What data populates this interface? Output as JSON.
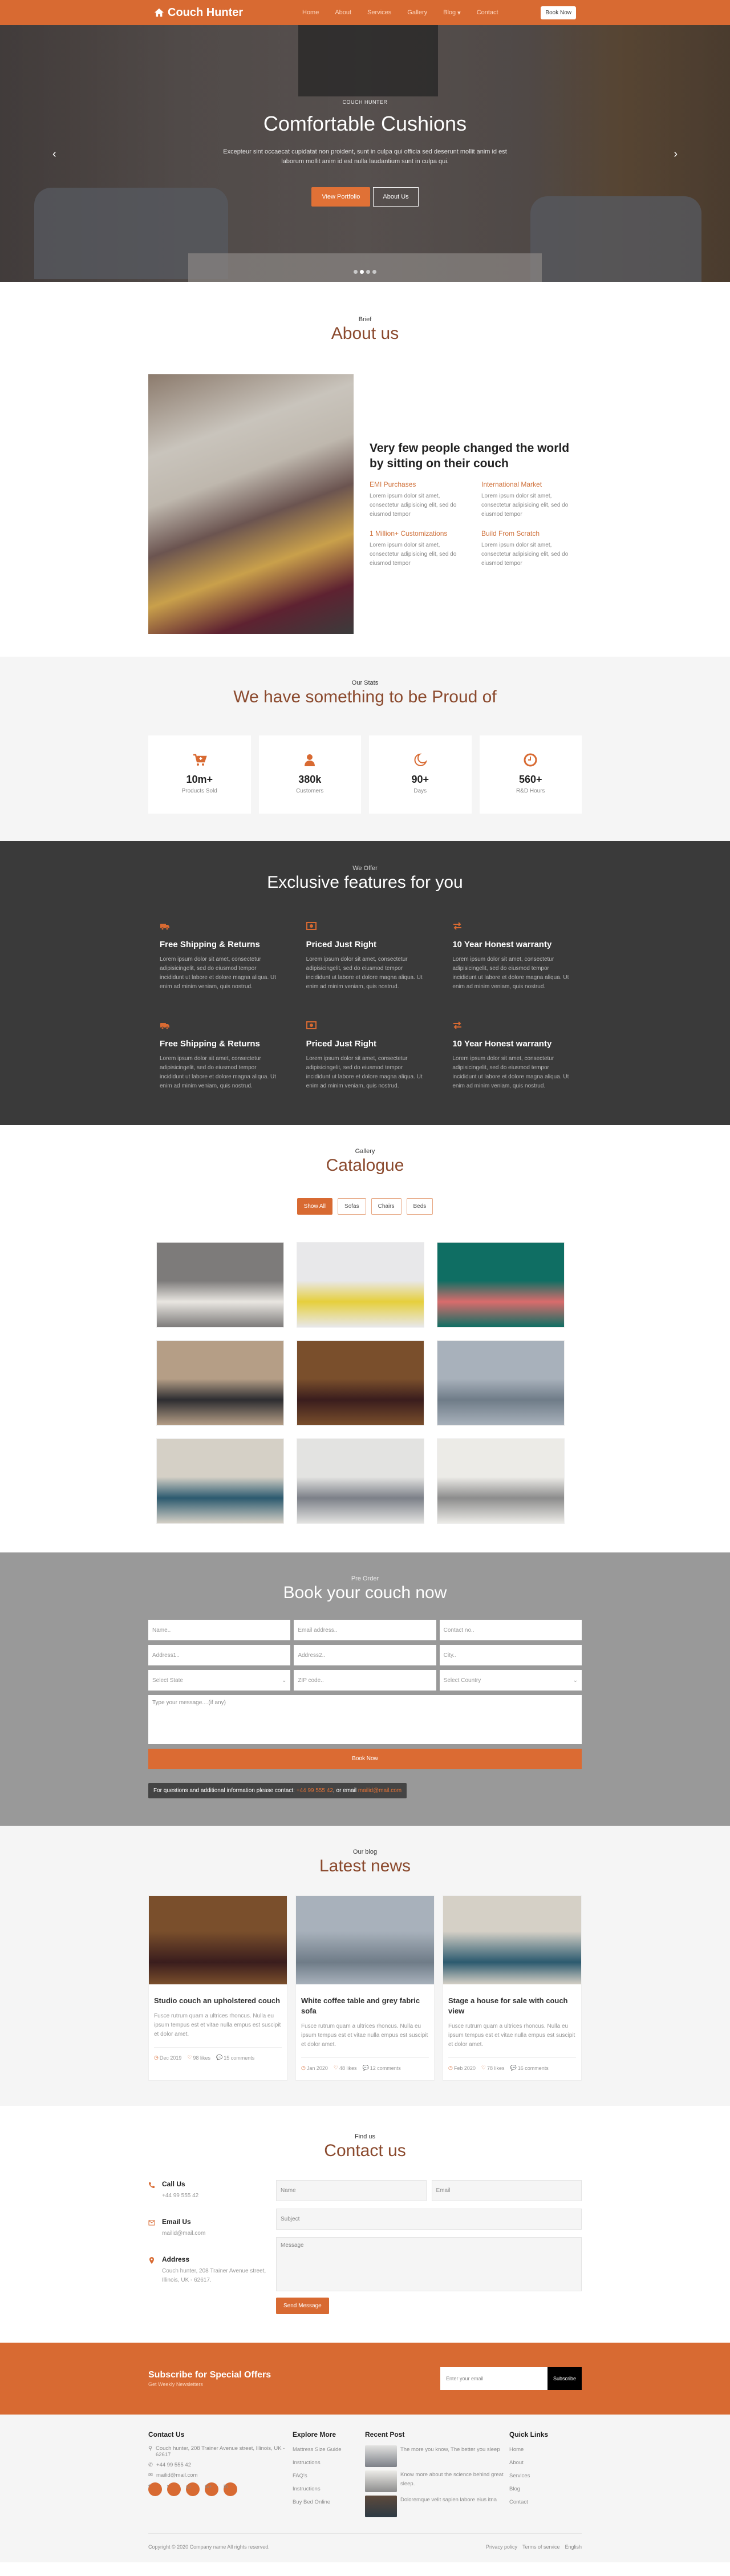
{
  "header": {
    "brand": "Couch Hunter",
    "nav": [
      {
        "label": "Home"
      },
      {
        "label": "About"
      },
      {
        "label": "Services"
      },
      {
        "label": "Gallery"
      },
      {
        "label": "Blog",
        "has_dropdown": true
      },
      {
        "label": "Contact"
      }
    ],
    "cta": "Book Now"
  },
  "hero": {
    "kicker": "COUCH HUNTER",
    "title": "Comfortable Cushions",
    "text": "Excepteur sint occaecat cupidatat non proident, sunt in culpa qui officia sed deserunt mollit anim id est laborum mollit anim id est nulla laudantium sunt in culpa qui.",
    "primary_btn": "View Portfolio",
    "secondary_btn": "About Us",
    "slides": 4,
    "active_slide": 2
  },
  "about": {
    "kicker": "Brief",
    "title": "About us",
    "headline": "Very few people changed the world by sitting on their couch",
    "items": [
      {
        "title": "EMI Purchases",
        "text": "Lorem ipsum dolor sit amet, consectetur adipisicing elit, sed do eiusmod tempor"
      },
      {
        "title": "International Market",
        "text": "Lorem ipsum dolor sit amet, consectetur adipisicing elit, sed do eiusmod tempor"
      },
      {
        "title": "1 Million+ Customizations",
        "text": "Lorem ipsum dolor sit amet, consectetur adipisicing elit, sed do eiusmod tempor"
      },
      {
        "title": "Build From Scratch",
        "text": "Lorem ipsum dolor sit amet, consectetur adipisicing elit, sed do eiusmod tempor"
      }
    ]
  },
  "stats": {
    "kicker": "Our Stats",
    "title": "We have something to be Proud of",
    "items": [
      {
        "icon": "cart-plus-icon",
        "value": "10m+",
        "label": "Products Sold"
      },
      {
        "icon": "user-icon",
        "value": "380k",
        "label": "Customers"
      },
      {
        "icon": "moon-icon",
        "value": "90+",
        "label": "Days"
      },
      {
        "icon": "clock-icon",
        "value": "560+",
        "label": "R&D Hours"
      }
    ]
  },
  "features": {
    "kicker": "We Offer",
    "title": "Exclusive features for you",
    "items": [
      {
        "icon": "truck-icon",
        "title": "Free Shipping & Returns",
        "text": "Lorem ipsum dolor sit amet, consectetur adipisicingelit, sed do eiusmod tempor incididunt ut labore et dolore magna aliqua. Ut enim ad minim veniam, quis nostrud."
      },
      {
        "icon": "money-icon",
        "title": "Priced Just Right",
        "text": "Lorem ipsum dolor sit amet, consectetur adipisicingelit, sed do eiusmod tempor incididunt ut labore et dolore magna aliqua. Ut enim ad minim veniam, quis nostrud."
      },
      {
        "icon": "exchange-icon",
        "title": "10 Year Honest warranty",
        "text": "Lorem ipsum dolor sit amet, consectetur adipisicingelit, sed do eiusmod tempor incididunt ut labore et dolore magna aliqua. Ut enim ad minim veniam, quis nostrud."
      },
      {
        "icon": "truck-icon",
        "title": "Free Shipping & Returns",
        "text": "Lorem ipsum dolor sit amet, consectetur adipisicingelit, sed do eiusmod tempor incididunt ut labore et dolore magna aliqua. Ut enim ad minim veniam, quis nostrud."
      },
      {
        "icon": "money-icon",
        "title": "Priced Just Right",
        "text": "Lorem ipsum dolor sit amet, consectetur adipisicingelit, sed do eiusmod tempor incididunt ut labore et dolore magna aliqua. Ut enim ad minim veniam, quis nostrud."
      },
      {
        "icon": "exchange-icon",
        "title": "10 Year Honest warranty",
        "text": "Lorem ipsum dolor sit amet, consectetur adipisicingelit, sed do eiusmod tempor incididunt ut labore et dolore magna aliqua. Ut enim ad minim veniam, quis nostrud."
      }
    ]
  },
  "gallery": {
    "kicker": "Gallery",
    "title": "Catalogue",
    "filters": [
      {
        "label": "Show All",
        "active": true
      },
      {
        "label": "Sofas",
        "active": false
      },
      {
        "label": "Chairs",
        "active": false
      },
      {
        "label": "Beds",
        "active": false
      }
    ],
    "images": [
      {
        "alt": "showroom grey and white sofas",
        "colors": [
          "#7d7b7a",
          "#e9e6e1"
        ]
      },
      {
        "alt": "yellow loveseat in white room",
        "colors": [
          "#e8e8ea",
          "#e6cf3c"
        ]
      },
      {
        "alt": "pink cushions on teal lounge",
        "colors": [
          "#0f6e63",
          "#d96c6c"
        ]
      },
      {
        "alt": "dark sectional sofa with rug",
        "colors": [
          "#b59e86",
          "#2d2d31"
        ]
      },
      {
        "alt": "antique striped couch",
        "colors": [
          "#7a4f2c",
          "#3a1d1d"
        ]
      },
      {
        "alt": "grey sofa with yellow chair",
        "colors": [
          "#a8b1bb",
          "#6f7c88"
        ]
      },
      {
        "alt": "white loveseat with teal pillows",
        "colors": [
          "#d5d0c6",
          "#2c5a6f"
        ]
      },
      {
        "alt": "grey sofa with floral painting",
        "colors": [
          "#e3e3e1",
          "#7c8088"
        ]
      },
      {
        "alt": "tufted grey sofa by window",
        "colors": [
          "#ecebe7",
          "#8c8c8c"
        ]
      }
    ]
  },
  "booking": {
    "kicker": "Pre Order",
    "title": "Book your couch now",
    "fields": {
      "name": "Name..",
      "email": "Email address..",
      "contact": "Contact no..",
      "address1": "Address1..",
      "address2": "Address2..",
      "city": "City..",
      "state": "Select State",
      "zip": "ZIP code..",
      "country": "Select Country",
      "message": "Type your message....(if any)"
    },
    "submit": "Book Now",
    "info_prefix": "For questions and additional information please contact: ",
    "info_phone": "+44 99 555 42",
    "info_mid": ", or email ",
    "info_email": "mailid@mail.com"
  },
  "blog": {
    "kicker": "Our blog",
    "title": "Latest news",
    "posts": [
      {
        "title": "Studio couch an upholstered couch",
        "text": "Fusce rutrum quam a ultrices rhoncus. Nulla eu ipsum tempus est et vitae nulla empus est suscipit et dolor amet.",
        "date": "Dec 2019",
        "likes": "98 likes",
        "comments": "15 comments",
        "colors": [
          "#7a4f2c",
          "#3a1d1d"
        ]
      },
      {
        "title": "White coffee table and grey fabric sofa",
        "text": "Fusce rutrum quam a ultrices rhoncus. Nulla eu ipsum tempus est et vitae nulla empus est suscipit et dolor amet.",
        "date": "Jan 2020",
        "likes": "48 likes",
        "comments": "12 comments",
        "colors": [
          "#a8b1bb",
          "#6f7c88"
        ]
      },
      {
        "title": "Stage a house for sale with couch view",
        "text": "Fusce rutrum quam a ultrices rhoncus. Nulla eu ipsum tempus est et vitae nulla empus est suscipit et dolor amet.",
        "date": "Feb 2020",
        "likes": "78 likes",
        "comments": "16 comments",
        "colors": [
          "#d5d0c6",
          "#2c5a6f"
        ]
      }
    ]
  },
  "contact": {
    "kicker": "Find us",
    "title": "Contact us",
    "items": [
      {
        "icon": "phone-icon",
        "title": "Call Us",
        "text": "+44 99 555 42"
      },
      {
        "icon": "envelope-icon",
        "title": "Email Us",
        "text": "mailid@mail.com"
      },
      {
        "icon": "map-marker-icon",
        "title": "Address",
        "text": "Couch hunter, 208 Trainer Avenue street, Illinois, UK - 62617."
      }
    ],
    "form": {
      "name": "Name",
      "email": "Email",
      "subject": "Subject",
      "message": "Message",
      "submit": "Send Message"
    }
  },
  "subscribe": {
    "title": "Subscribe for Special Offers",
    "subtitle": "Get Weekly Newsletters",
    "placeholder": "Enter your email",
    "button": "Subscribe"
  },
  "footer": {
    "contact": {
      "title": "Contact Us",
      "address": "Couch hunter, 208 Trainer Avenue street, Illinois, UK - 62617",
      "phone": "+44 99 555 42",
      "email": "mailid@mail.com",
      "socials": [
        {
          "icon": "facebook-icon",
          "glyph": "f"
        },
        {
          "icon": "twitter-icon",
          "glyph": "t"
        },
        {
          "icon": "instagram-icon",
          "glyph": "◎"
        },
        {
          "icon": "google-plus-icon",
          "glyph": "G+"
        },
        {
          "icon": "linkedin-icon",
          "glyph": "in"
        }
      ]
    },
    "explore": {
      "title": "Explore More",
      "links": [
        "Mattress Size Guide",
        "Instructions",
        "FAQ's",
        "Instructions",
        "Buy Bed Online"
      ]
    },
    "recent": {
      "title": "Recent Post",
      "posts": [
        {
          "title": "The more you know, The better you sleep",
          "colors": [
            "#e3e3e1",
            "#7c8088"
          ]
        },
        {
          "title": "Know more about the science behind great sleep.",
          "colors": [
            "#ecebe7",
            "#8c8c8c"
          ]
        },
        {
          "title": "Doloremque velit sapien labore eius itna",
          "colors": [
            "#5e4a3c",
            "#2d3a44"
          ]
        }
      ]
    },
    "quick": {
      "title": "Quick Links",
      "links": [
        "Home",
        "About",
        "Services",
        "Blog",
        "Contact"
      ]
    },
    "copyright": "Copyright © 2020 Company name All rights reserved.",
    "bottom_links": [
      "Privacy policy",
      "Terms of service",
      "English"
    ]
  },
  "colors": {
    "accent": "#d86a32",
    "heading": "#8b4a2e",
    "dark_section": "#3a3a3a",
    "booking_section": "#999999"
  }
}
